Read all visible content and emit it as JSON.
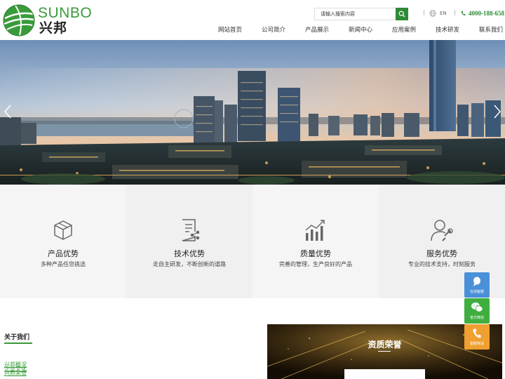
{
  "brand": {
    "name_en": "SUNBO",
    "name_cn": "兴邦",
    "accent_color": "#2e8b35"
  },
  "header": {
    "search_placeholder": "请输入搜索内容",
    "lang_label": "EN",
    "phone": "4000-188-658"
  },
  "nav": {
    "items": [
      "网站首页",
      "公司简介",
      "产品展示",
      "新闻中心",
      "应用案例",
      "技术研发",
      "联系我们"
    ]
  },
  "advantages": [
    {
      "icon": "box-icon",
      "title": "产品优势",
      "desc": "多种产品任您挑选"
    },
    {
      "icon": "document-tech-icon",
      "title": "技术优势",
      "desc": "走自主研发，不断创新的道路"
    },
    {
      "icon": "bar-chart-icon",
      "title": "质量优势",
      "desc": "完善的管理，生产良好的产品"
    },
    {
      "icon": "service-person-icon",
      "title": "服务优势",
      "desc": "专业的技术支持，时刻服务"
    }
  ],
  "about": {
    "title": "关于我们",
    "links": [
      "兴邦概况",
      "企业文化",
      "兴邦荣誉"
    ]
  },
  "honor": {
    "title": "资质荣誉"
  },
  "float_bar": [
    {
      "icon": "chat-bubble-icon",
      "label": "在线客服",
      "color": "#4a90d9"
    },
    {
      "icon": "wechat-icon",
      "label": "官方微信",
      "color": "#3fae3f"
    },
    {
      "icon": "phone-icon",
      "label": "客服电话",
      "color": "#f0a030"
    }
  ]
}
